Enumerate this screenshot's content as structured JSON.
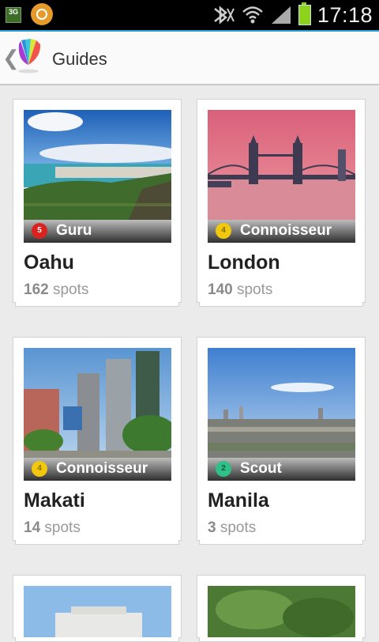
{
  "status_bar": {
    "network": "3G",
    "time": "17:18"
  },
  "action_bar": {
    "back_glyph": "❮",
    "title": "Guides"
  },
  "guides": [
    {
      "city": "Oahu",
      "badge": "Guru",
      "badge_level": "5",
      "badge_color": "#d9231e",
      "count": "162",
      "unit": " spots"
    },
    {
      "city": "London",
      "badge": "Connoisseur",
      "badge_level": "4",
      "badge_color": "#f2c80f",
      "count": "140",
      "unit": " spots"
    },
    {
      "city": "Makati",
      "badge": "Connoisseur",
      "badge_level": "4",
      "badge_color": "#f2c80f",
      "count": "14",
      "unit": " spots"
    },
    {
      "city": "Manila",
      "badge": "Scout",
      "badge_level": "2",
      "badge_color": "#2fbf87",
      "count": "3",
      "unit": " spots"
    }
  ]
}
